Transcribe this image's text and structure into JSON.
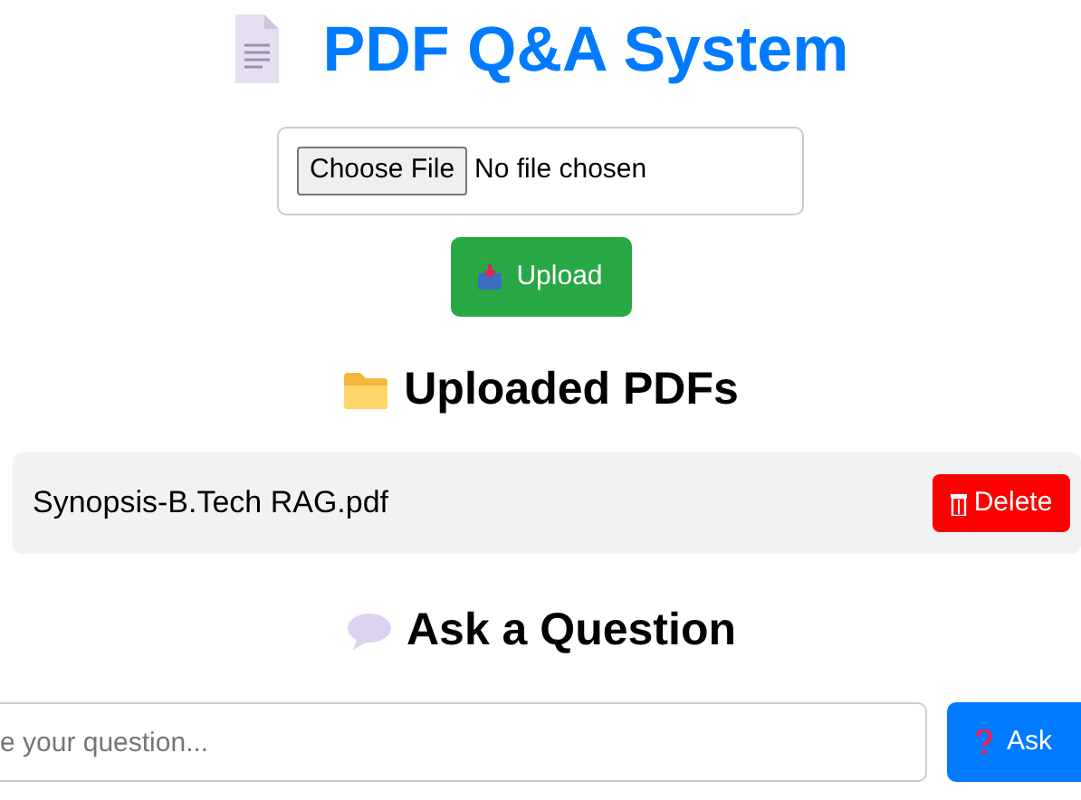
{
  "title": "PDF Q&A System",
  "file_picker": {
    "button": "Choose File",
    "status": "No file chosen"
  },
  "upload_button": "Upload",
  "uploaded_heading": "Uploaded PDFs",
  "files": [
    {
      "name": "Synopsis-B.Tech RAG.pdf",
      "action": "Delete"
    }
  ],
  "ask_heading": "Ask a Question",
  "question": {
    "placeholder": "e your question...",
    "button": "Ask"
  }
}
